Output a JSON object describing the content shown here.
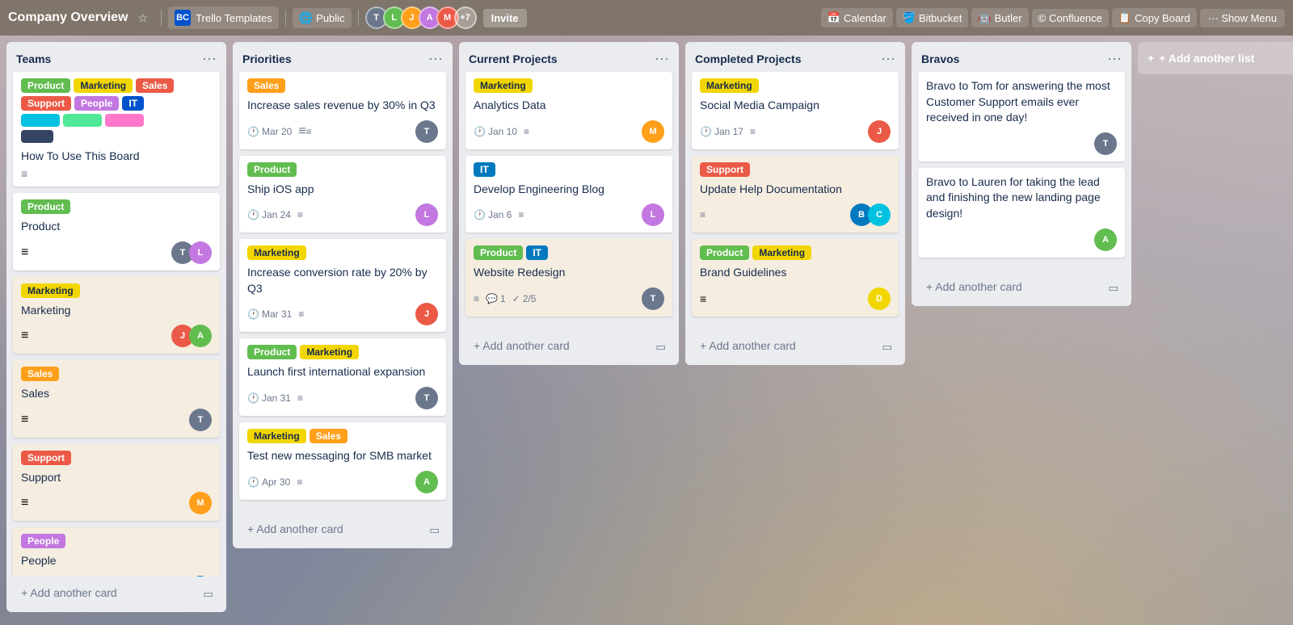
{
  "topbar": {
    "title": "Company Overview",
    "workspace_label": "Trello Templates",
    "workspace_code": "BC",
    "visibility": "Public",
    "member_count": "+7",
    "invite_label": "Invite",
    "tools": [
      {
        "id": "calendar",
        "label": "Calendar",
        "icon": "calendar-icon"
      },
      {
        "id": "bitbucket",
        "label": "Bitbucket",
        "icon": "bitbucket-icon"
      },
      {
        "id": "butler",
        "label": "Butler",
        "icon": "butler-icon"
      },
      {
        "id": "confluence",
        "label": "Confluence",
        "icon": "confluence-icon"
      },
      {
        "id": "copyboard",
        "label": "Copy Board",
        "icon": "copy-icon"
      }
    ],
    "more_label": "··· Show Menu",
    "add_another": "+ Add anoth..."
  },
  "lists": [
    {
      "id": "teams",
      "title": "Teams",
      "labels_row1": [
        "Product",
        "Marketing",
        "Sales"
      ],
      "labels_row2": [
        "Support",
        "People",
        "IT"
      ],
      "color_swatches": [
        "teal",
        "lime",
        "pink",
        "dark"
      ],
      "how_to_label": "How To Use This Board",
      "cards": [
        {
          "id": "product-card",
          "label": "Product",
          "label_color": "green",
          "title": "Product",
          "avatars": [
            "av1",
            "av2"
          ]
        },
        {
          "id": "marketing-card",
          "label": "Marketing",
          "label_color": "yellow",
          "title": "Marketing",
          "avatars": [
            "av3",
            "av4"
          ]
        },
        {
          "id": "sales-card",
          "label": "Sales",
          "label_color": "orange",
          "title": "Sales",
          "avatars": [
            "av1"
          ]
        },
        {
          "id": "support-card",
          "label": "Support",
          "label_color": "red",
          "title": "Support",
          "avatars": [
            "av5"
          ]
        },
        {
          "id": "people-card",
          "label": "People",
          "label_color": "purple",
          "title": "People",
          "avatars": [
            "av6"
          ]
        }
      ],
      "add_card_label": "+ Add another card"
    },
    {
      "id": "priorities",
      "title": "Priorities",
      "cards": [
        {
          "id": "p1",
          "labels": [
            {
              "text": "Sales",
              "color": "orange"
            }
          ],
          "title": "Increase sales revenue by 30% in Q3",
          "date": "Mar 20",
          "has_desc": true,
          "avatars": [
            "av1"
          ]
        },
        {
          "id": "p2",
          "labels": [
            {
              "text": "Product",
              "color": "green"
            }
          ],
          "title": "Ship iOS app",
          "date": "Jan 24",
          "has_desc": true,
          "avatars": [
            "av2"
          ]
        },
        {
          "id": "p3",
          "labels": [
            {
              "text": "Marketing",
              "color": "yellow"
            }
          ],
          "title": "Increase conversion rate by 20% by Q3",
          "date": "Mar 31",
          "has_desc": true,
          "avatars": [
            "av3"
          ]
        },
        {
          "id": "p4",
          "labels": [
            {
              "text": "Product",
              "color": "green"
            },
            {
              "text": "Marketing",
              "color": "yellow"
            }
          ],
          "title": "Launch first international expansion",
          "date": "Jan 31",
          "has_desc": true,
          "avatars": [
            "av1"
          ]
        },
        {
          "id": "p5",
          "labels": [
            {
              "text": "Marketing",
              "color": "yellow"
            },
            {
              "text": "Sales",
              "color": "orange"
            }
          ],
          "title": "Test new messaging for SMB market",
          "date": "Apr 30",
          "has_desc": true,
          "avatars": [
            "av4"
          ]
        }
      ],
      "add_card_label": "+ Add another card"
    },
    {
      "id": "current-projects",
      "title": "Current Projects",
      "cards": [
        {
          "id": "cp1",
          "labels": [
            {
              "text": "Marketing",
              "color": "yellow"
            }
          ],
          "title": "Analytics Data",
          "date": "Jan 10",
          "has_desc": true,
          "avatars": [
            "av5"
          ]
        },
        {
          "id": "cp2",
          "labels": [
            {
              "text": "IT",
              "color": "it"
            }
          ],
          "title": "Develop Engineering Blog",
          "date": "Jan 6",
          "has_desc": true,
          "avatars": [
            "av2"
          ]
        },
        {
          "id": "cp3",
          "labels": [
            {
              "text": "Product",
              "color": "green"
            },
            {
              "text": "IT",
              "color": "it"
            }
          ],
          "title": "Website Redesign",
          "has_desc": true,
          "comments": "1",
          "checklist": "2/5",
          "avatars": [
            "av1"
          ]
        }
      ],
      "add_card_label": "+ Add another card"
    },
    {
      "id": "completed-projects",
      "title": "Completed Projects",
      "cards": [
        {
          "id": "comp1",
          "labels": [
            {
              "text": "Marketing",
              "color": "yellow"
            }
          ],
          "title": "Social Media Campaign",
          "date": "Jan 17",
          "has_desc": true,
          "avatars": [
            "av3"
          ]
        },
        {
          "id": "comp2",
          "labels": [
            {
              "text": "Support",
              "color": "red"
            }
          ],
          "title": "Update Help Documentation",
          "has_desc": true,
          "avatars": [
            "av6",
            "av7"
          ]
        },
        {
          "id": "comp3",
          "labels": [
            {
              "text": "Product",
              "color": "green"
            },
            {
              "text": "Marketing",
              "color": "yellow"
            }
          ],
          "title": "Brand Guidelines",
          "has_desc": true,
          "avatars": [
            "av8"
          ]
        }
      ],
      "add_card_label": "+ Add another card"
    },
    {
      "id": "bravos",
      "title": "Bravos",
      "cards": [
        {
          "id": "b1",
          "title": "Bravo to Tom for answering the most Customer Support emails ever received in one day!",
          "avatars": [
            "av1"
          ]
        },
        {
          "id": "b2",
          "title": "Bravo to Lauren for taking the lead and finishing the new landing page design!",
          "avatars": [
            "av4"
          ]
        }
      ],
      "add_card_label": "+ Add another card"
    }
  ],
  "add_list_label": "+ Add another list",
  "label_colors": {
    "green": "#61bd4f",
    "yellow": "#f2d600",
    "orange": "#ff9f1a",
    "red": "#eb5a46",
    "purple": "#c377e0",
    "it": "#0079bf",
    "teal": "#00c2e0"
  }
}
